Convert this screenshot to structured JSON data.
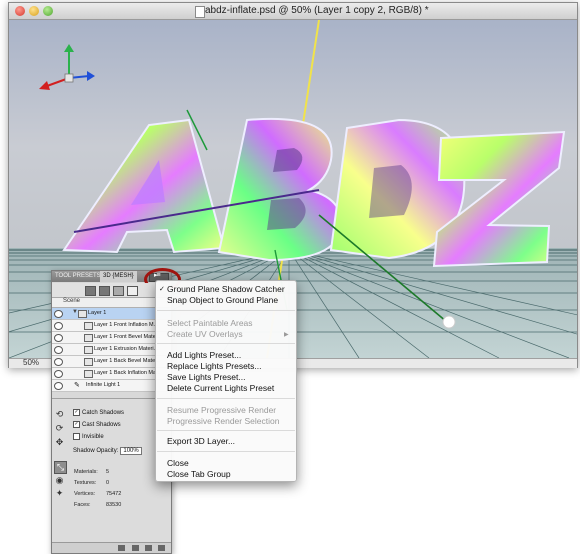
{
  "window": {
    "title": "abdz-inflate.psd @ 50% (Layer 1 copy 2, RGB/8) *",
    "zoom": "50%"
  },
  "panel": {
    "tabs": {
      "tool_presets": "TOOL PRESETS",
      "mesh": "3D {MESH}"
    },
    "menu_button": "▸≡",
    "scene_label": "Scene",
    "layers": [
      "Layer 1",
      "Layer 1 Front Inflation M...",
      "Layer 1 Front Bevel Mate...",
      "Layer 1 Extrusion Materi...",
      "Layer 1 Back Bevel Mate...",
      "Layer 1 Back Inflation Ma...",
      "Infinite Light 1"
    ],
    "options": {
      "catch_shadows": "Catch Shadows",
      "cast_shadows": "Cast Shadows",
      "invisible": "Invisible",
      "shadow_opacity_label": "Shadow Opacity:",
      "shadow_opacity_value": "100%"
    },
    "stats": [
      {
        "label": "Materials:",
        "value": "5"
      },
      {
        "label": "Textures:",
        "value": "0"
      },
      {
        "label": "Vertices:",
        "value": "75472"
      },
      {
        "label": "Faces:",
        "value": "83530"
      }
    ]
  },
  "menu": {
    "items": [
      "Ground Plane Shadow Catcher",
      "Snap Object to Ground Plane",
      "Select Paintable Areas",
      "Create UV Overlays",
      "Add Lights Preset...",
      "Replace Lights Presets...",
      "Save Lights Preset...",
      "Delete Current Lights Preset",
      "Resume Progressive Render",
      "Progressive Render Selection",
      "Export 3D Layer...",
      "Close",
      "Close Tab Group"
    ]
  },
  "colors": {
    "highlight_ring": "#a1140f",
    "sky_top": "#a9b3c8",
    "grid_line": "#4a6a6c"
  }
}
